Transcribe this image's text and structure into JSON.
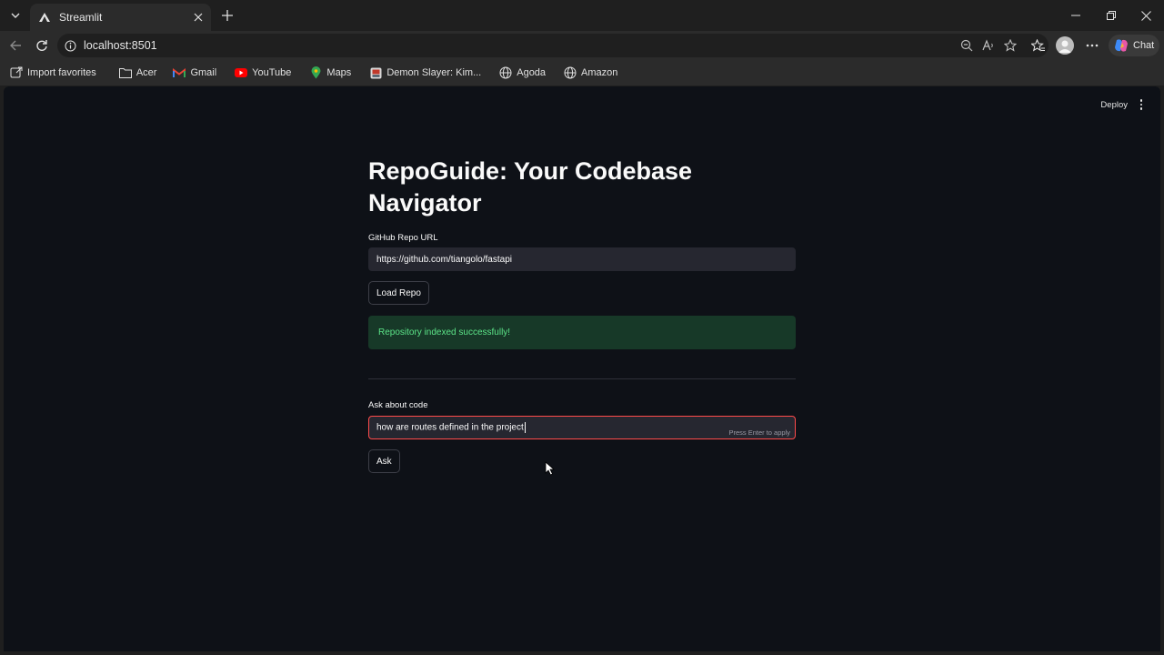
{
  "browser": {
    "tab_title": "Streamlit",
    "url": "localhost:8501",
    "chat_label": "Chat",
    "bookmarks": [
      {
        "label": "Import favorites",
        "icon": "import-icon"
      },
      {
        "label": "Acer",
        "icon": "folder-icon"
      },
      {
        "label": "Gmail",
        "icon": "gmail-icon"
      },
      {
        "label": "YouTube",
        "icon": "youtube-icon"
      },
      {
        "label": "Maps",
        "icon": "maps-icon"
      },
      {
        "label": "Demon Slayer: Kim...",
        "icon": "site-icon"
      },
      {
        "label": "Agoda",
        "icon": "globe-icon"
      },
      {
        "label": "Amazon",
        "icon": "globe-icon"
      }
    ]
  },
  "app": {
    "deploy_label": "Deploy",
    "title": "RepoGuide: Your Codebase Navigator",
    "repo_label": "GitHub Repo URL",
    "repo_value": "https://github.com/tiangolo/fastapi",
    "load_button": "Load Repo",
    "success_message": "Repository indexed successfully!",
    "question_label": "Ask about code",
    "question_value": "how are routes defined in the project",
    "question_hint": "Press Enter to apply",
    "ask_button": "Ask"
  },
  "colors": {
    "background": "#0e1117",
    "input_bg": "#262730",
    "focus_border": "#ff4b4b",
    "success_bg": "#173928",
    "success_text": "#5ce488"
  }
}
